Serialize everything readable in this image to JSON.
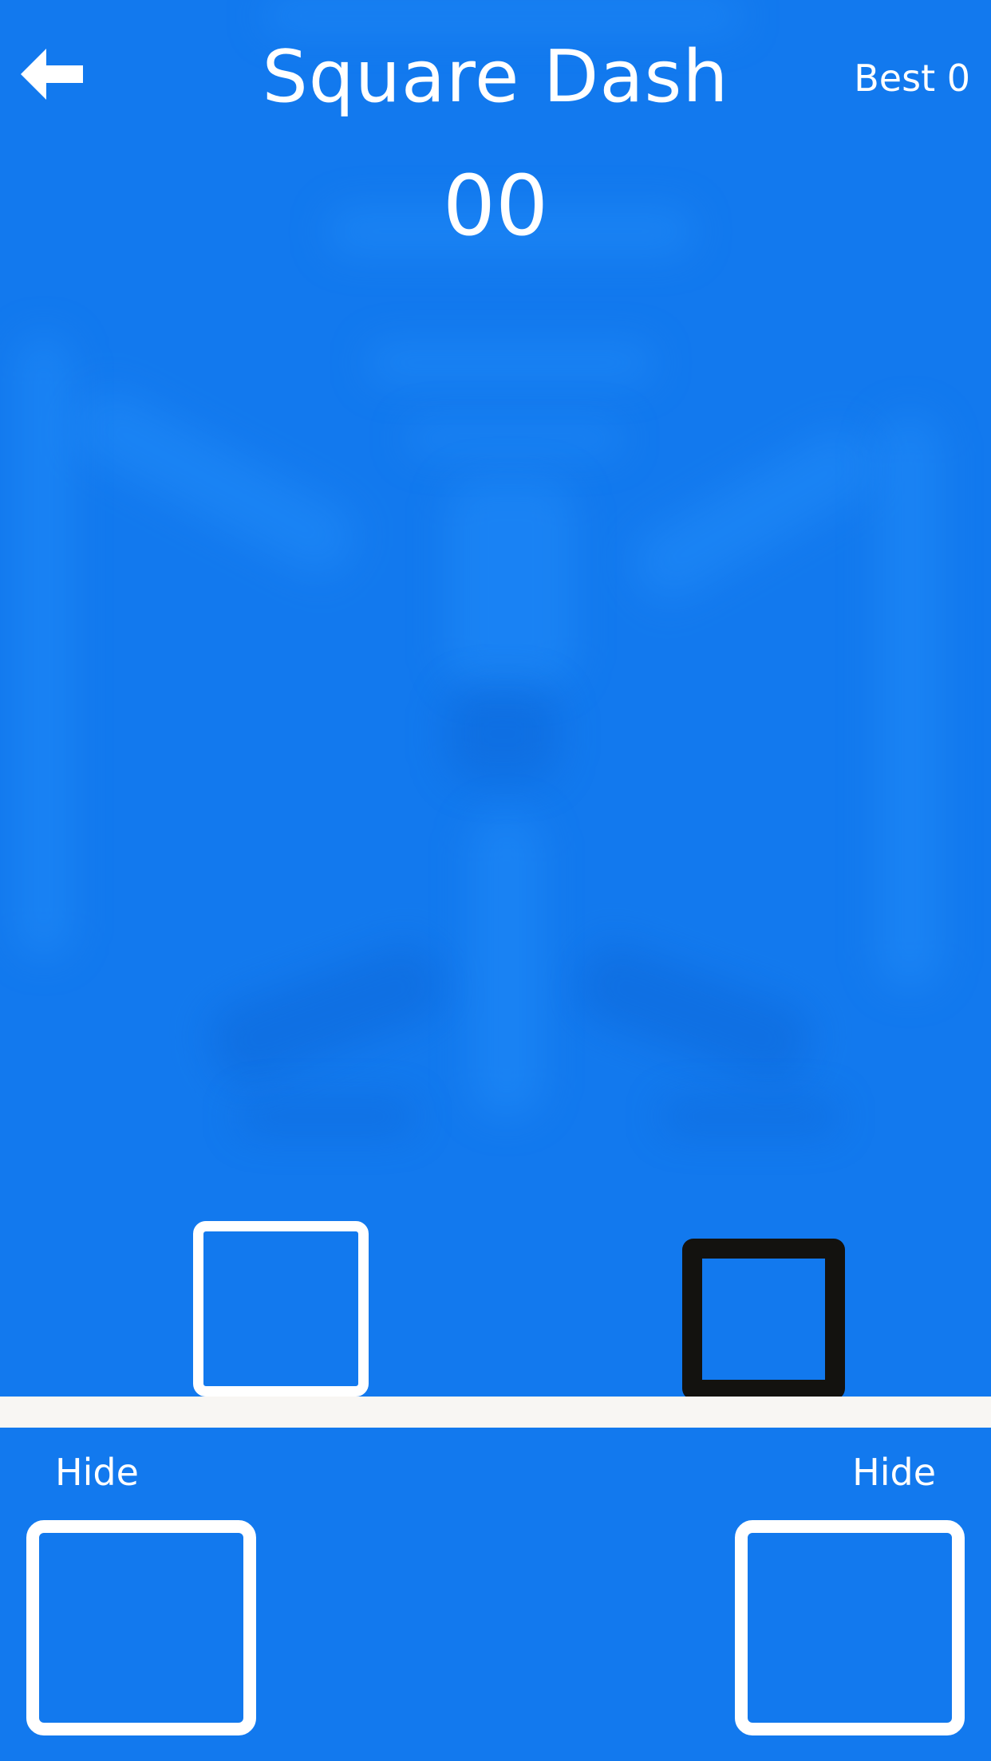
{
  "header": {
    "title": "Square Dash",
    "best_label": "Best 0",
    "back_icon": "arrow-left-icon"
  },
  "game": {
    "score": "00"
  },
  "controls": {
    "left_label": "Hide",
    "right_label": "Hide"
  },
  "colors": {
    "background": "#1279ee",
    "player": "#ffffff",
    "obstacle": "#13120f",
    "ground": "#f8f6f3",
    "text": "#ffffff"
  }
}
